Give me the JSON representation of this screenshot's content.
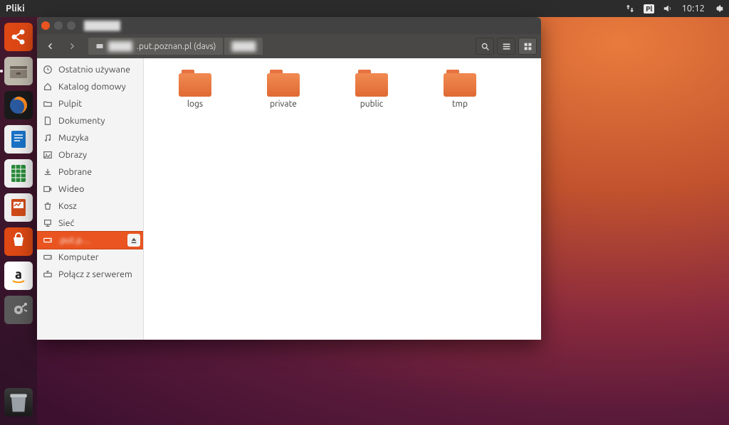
{
  "topbar": {
    "app_name": "Pliki",
    "kb_layout": "Pl",
    "clock": "10:12"
  },
  "launcher": {
    "items": [
      {
        "name": "ubuntu-dash",
        "bg": "#dd4814"
      },
      {
        "name": "files",
        "bg": "#e5e5e5"
      },
      {
        "name": "firefox",
        "bg": "#222"
      },
      {
        "name": "writer",
        "bg": "#1a73c7"
      },
      {
        "name": "calc",
        "bg": "#2a8a3a"
      },
      {
        "name": "impress",
        "bg": "#d04b1a"
      },
      {
        "name": "software",
        "bg": "#dd4814"
      },
      {
        "name": "amazon",
        "bg": "#ffffff"
      },
      {
        "name": "settings",
        "bg": "#555"
      }
    ]
  },
  "filemanager": {
    "toolbar": {
      "path_main": ".put.poznan.pl (davs)",
      "path_sub": ""
    },
    "sidebar": {
      "items": [
        {
          "key": "recent",
          "label": "Ostatnio używane",
          "icon": "clock"
        },
        {
          "key": "home",
          "label": "Katalog domowy",
          "icon": "home"
        },
        {
          "key": "desktop",
          "label": "Pulpit",
          "icon": "folder"
        },
        {
          "key": "documents",
          "label": "Dokumenty",
          "icon": "doc"
        },
        {
          "key": "music",
          "label": "Muzyka",
          "icon": "music"
        },
        {
          "key": "pictures",
          "label": "Obrazy",
          "icon": "picture"
        },
        {
          "key": "downloads",
          "label": "Pobrane",
          "icon": "download"
        },
        {
          "key": "videos",
          "label": "Wideo",
          "icon": "video"
        },
        {
          "key": "trash",
          "label": "Kosz",
          "icon": "trash"
        },
        {
          "key": "network",
          "label": "Sieć",
          "icon": "net"
        },
        {
          "key": "mnt",
          "label": ".put.p…",
          "icon": "drive",
          "selected": true,
          "ejectable": true,
          "blur": true
        },
        {
          "key": "computer",
          "label": "Komputer",
          "icon": "drive"
        },
        {
          "key": "connect",
          "label": "Połącz z serwerem",
          "icon": "connect"
        }
      ]
    },
    "folders": [
      {
        "name": "logs"
      },
      {
        "name": "private"
      },
      {
        "name": "public"
      },
      {
        "name": "tmp"
      }
    ]
  }
}
